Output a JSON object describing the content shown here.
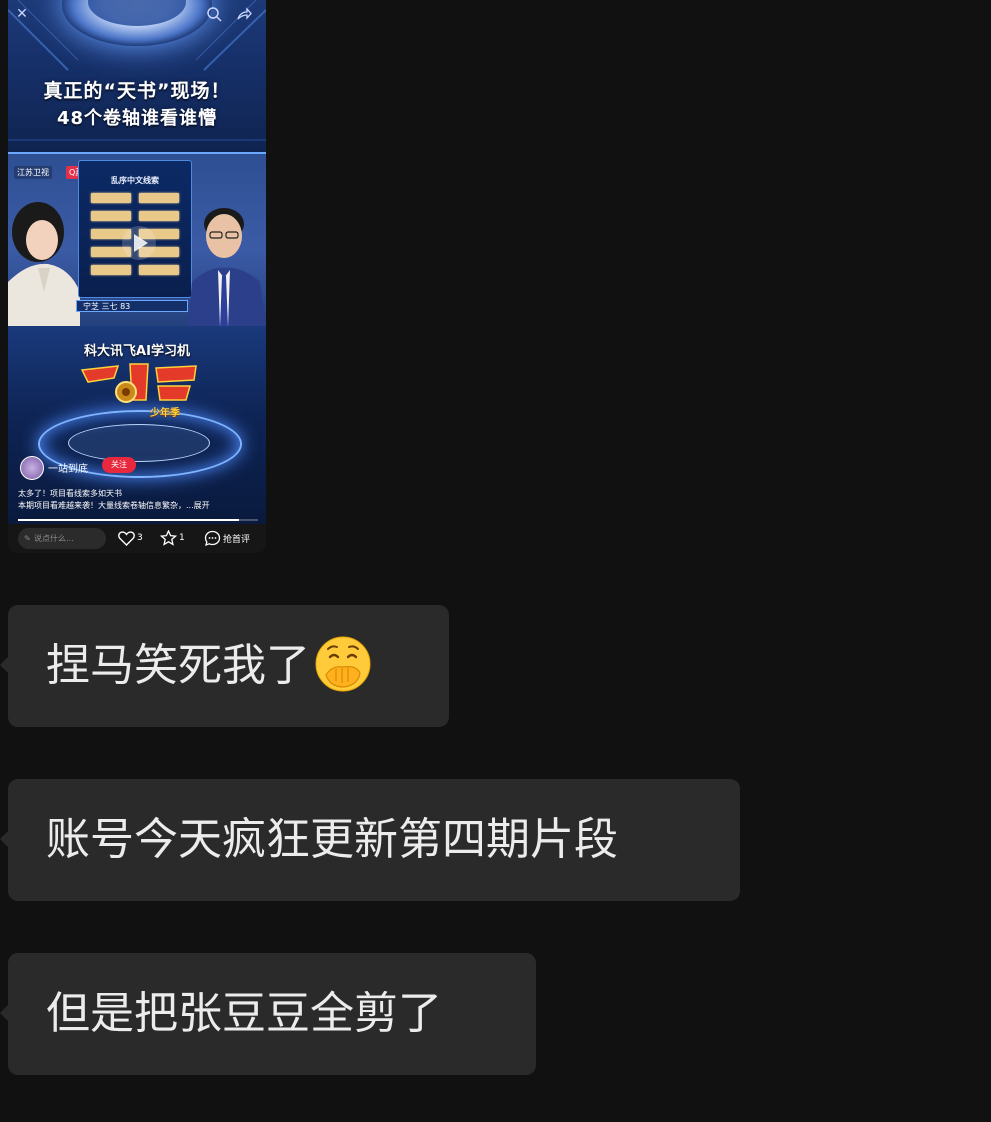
{
  "video_card": {
    "headline_line1": "真正的“天书”现场！",
    "headline_line2": "48个卷轴谁看谁懵",
    "channel_logo_1": "江苏卫视",
    "channel_logo_2": "Q荔枝",
    "board_title": "乱序中文线索",
    "name_tag": "宁芝  三七 83",
    "sponsor": "科大讯飞AI学习机",
    "show_subtitle": "少年季",
    "author": "一站到底",
    "follow_label": "关注",
    "caption_line1": "太多了！项目看线索多如天书",
    "caption_line2": "本期项目看难越来袭！大量线索卷轴信息繁杂，...展开",
    "progress": 0.92,
    "comment_placeholder": "说点什么...",
    "like_count": "3",
    "favorite_count": "1",
    "comment_label": "抢首评"
  },
  "messages": [
    {
      "text": "捏马笑死我了",
      "emoji": "face-with-hand-over-mouth"
    },
    {
      "text": "账号今天疯狂更新第四期片段"
    },
    {
      "text": "但是把张豆豆全剪了"
    }
  ],
  "colors": {
    "background": "#111111",
    "bubble": "#2a2a2a",
    "bubble_text": "#ececec",
    "follow": "#e8283c"
  }
}
